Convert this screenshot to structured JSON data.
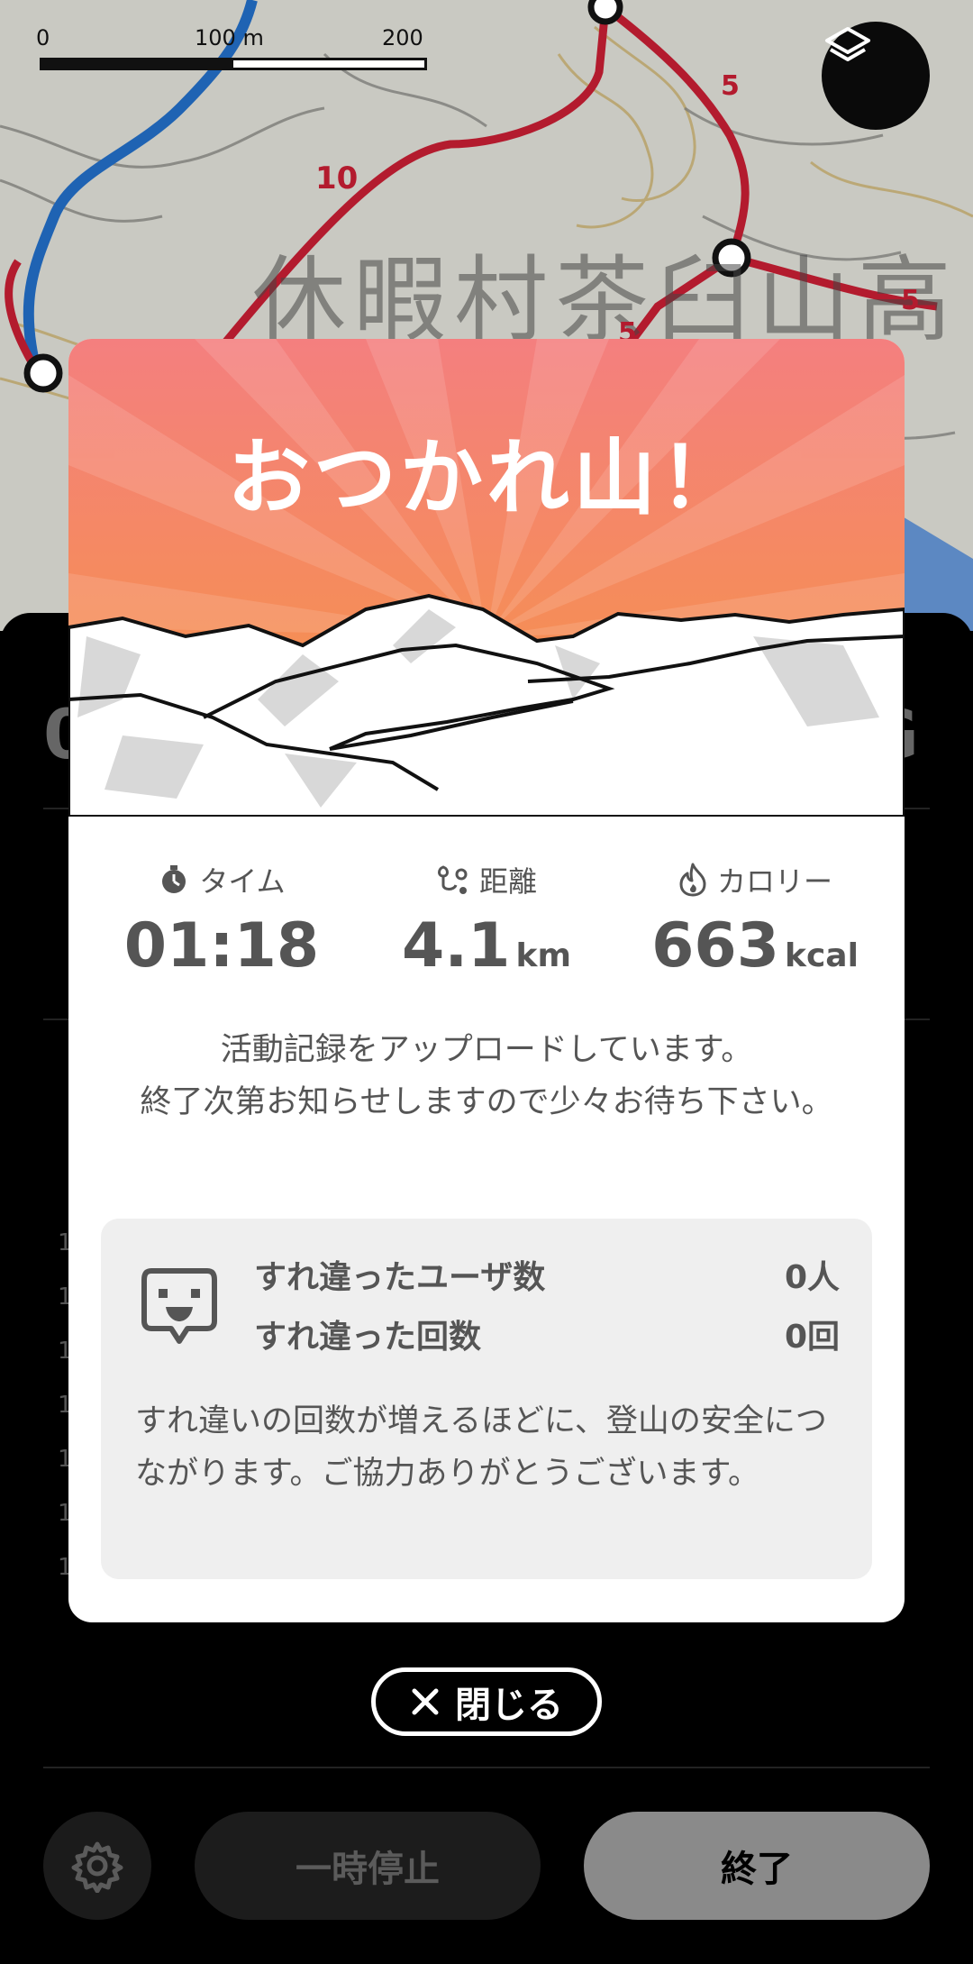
{
  "map": {
    "place_name": "休暇村茶臼山高",
    "contour_labels": [
      "10",
      "5",
      "5",
      "5"
    ],
    "scale": {
      "ticks": [
        "0",
        "100 m",
        "200 m"
      ]
    },
    "layer_icon": "layers-icon"
  },
  "sheet": {
    "big_left": "0",
    "big_right": "G",
    "row_digits": [
      "1",
      "1",
      "1",
      "1",
      "1",
      "1",
      "1"
    ]
  },
  "modal": {
    "title": "おつかれ山！",
    "stats": {
      "time": {
        "label": "タイム",
        "value": "01:18",
        "icon": "stopwatch-icon"
      },
      "distance": {
        "label": "距離",
        "value": "4.1",
        "unit": "km",
        "icon": "route-pin-icon"
      },
      "calories": {
        "label": "カロリー",
        "value": "663",
        "unit": "kcal",
        "icon": "flame-icon"
      }
    },
    "upload_message": "活動記録をアップロードしています。\n終了次第お知らせしますので少々お待ち下さい。",
    "pass": {
      "icon": "chat-face-icon",
      "users_label": "すれ違ったユーザ数",
      "users_value": "0人",
      "count_label": "すれ違った回数",
      "count_value": "0回",
      "note": "すれ違いの回数が増えるほどに、登山の安全につながります。ご協力ありがとうございます。"
    }
  },
  "close_button": {
    "label": "閉じる",
    "icon": "close-icon"
  },
  "bottom_bar": {
    "settings_icon": "gear-icon",
    "pause_label": "一時停止",
    "end_label": "終了"
  },
  "colors": {
    "route_red": "#b31b2e",
    "route_blue": "#1f63b3",
    "hero_top": "#f47f7f",
    "hero_bottom": "#f6963f",
    "text_gray": "#555555"
  }
}
